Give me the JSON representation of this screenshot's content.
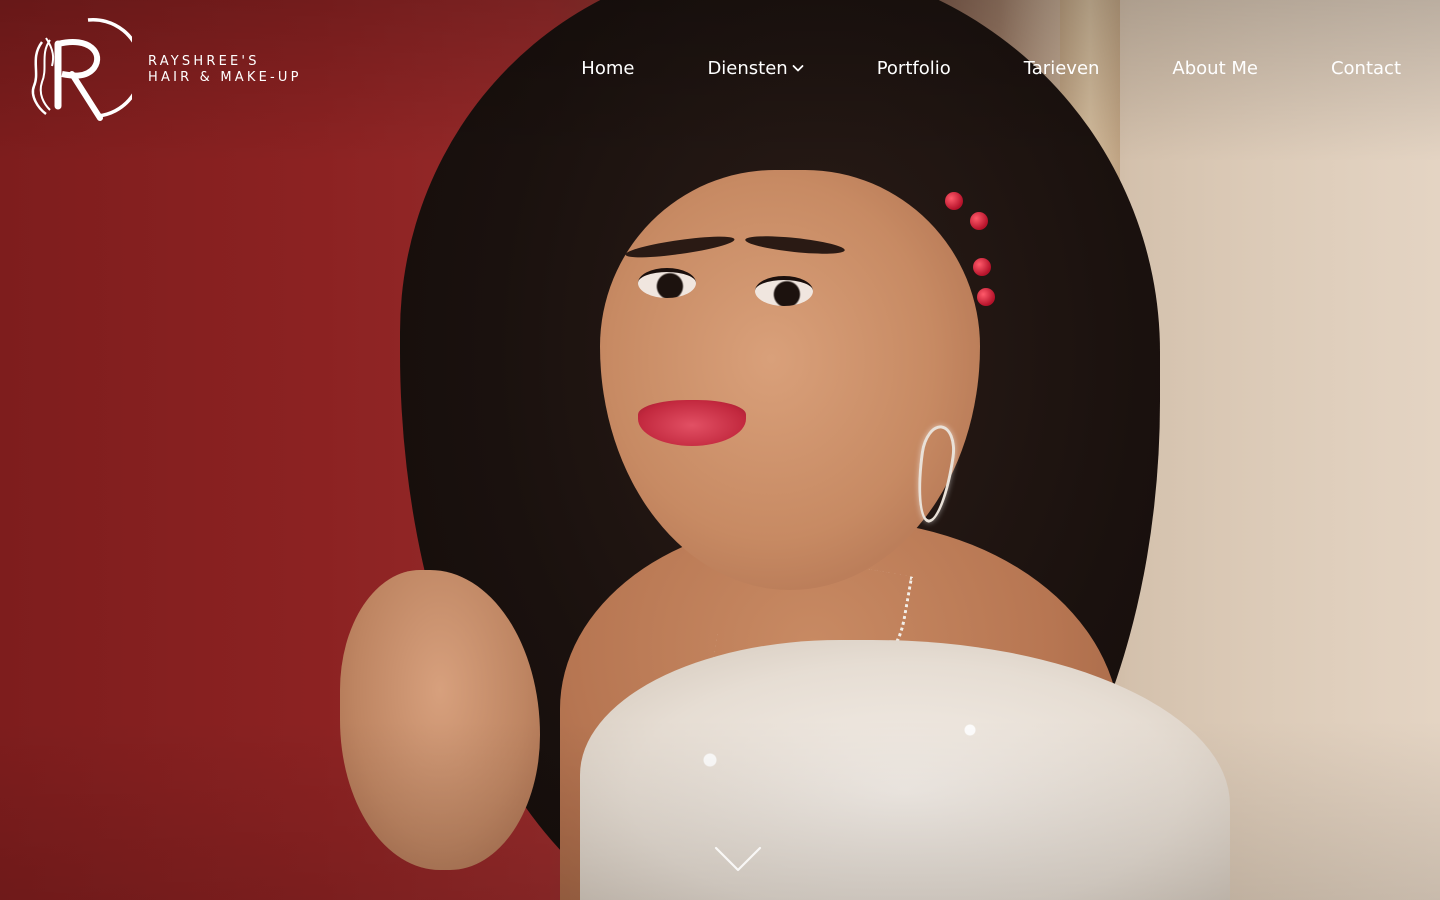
{
  "brand": {
    "line1": "RAYSHREE'S",
    "line2": "HAIR & MAKE-UP",
    "logo_icon": "rayshree-r-monogram-icon"
  },
  "nav": {
    "items": [
      {
        "label": "Home"
      },
      {
        "label": "Diensten",
        "icon": "chevron-down-icon"
      },
      {
        "label": "Portfolio"
      },
      {
        "label": "Tarieven"
      },
      {
        "label": "About Me"
      },
      {
        "label": "Contact"
      }
    ]
  },
  "hero": {
    "scroll_icon": "chevron-down-icon"
  },
  "colors": {
    "nav_text": "#ffffff",
    "backdrop_red": "#8c2222",
    "backdrop_beige": "#e3d2bf"
  }
}
